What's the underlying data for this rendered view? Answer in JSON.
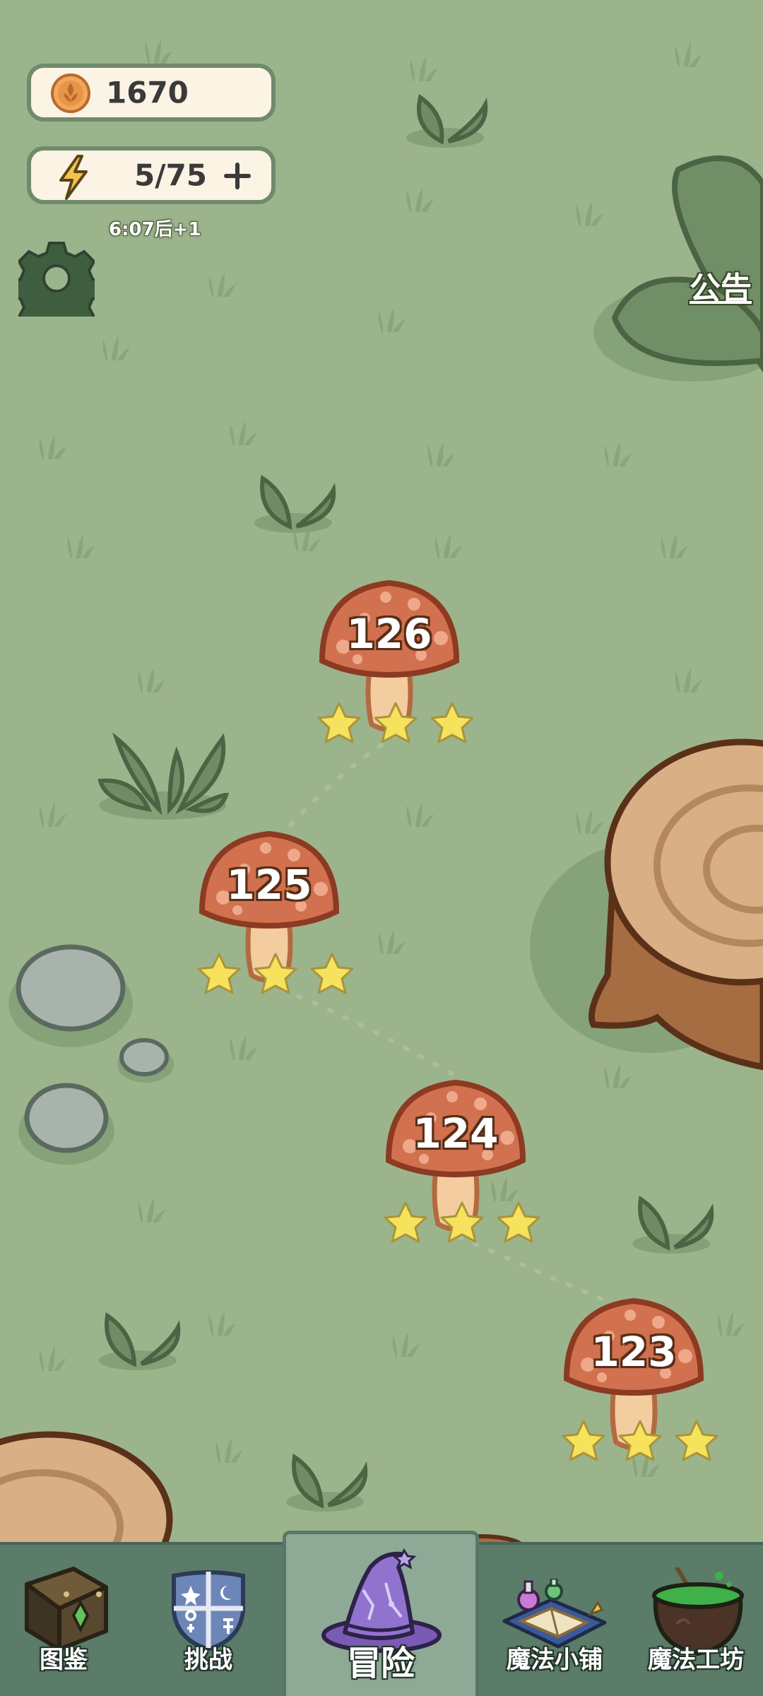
{
  "currency": {
    "coins": "1670",
    "icon": "coin-icon"
  },
  "energy": {
    "value": "5/75",
    "timer": "6:07后+1",
    "icon": "lightning-bolt-icon"
  },
  "notice": {
    "label": "公告"
  },
  "levels": [
    {
      "number": "126",
      "stars": 3
    },
    {
      "number": "125",
      "stars": 3
    },
    {
      "number": "124",
      "stars": 3
    },
    {
      "number": "123",
      "stars": 3
    }
  ],
  "nav": {
    "items": [
      {
        "label": "图鉴",
        "icon": "book-icon"
      },
      {
        "label": "挑战",
        "icon": "shield-icon"
      },
      {
        "label": "冒险",
        "icon": "wizard-hat-icon",
        "active": true
      },
      {
        "label": "魔法小铺",
        "icon": "shop-icon"
      },
      {
        "label": "魔法工坊",
        "icon": "cauldron-icon"
      }
    ]
  },
  "colors": {
    "background": "#9cb48c",
    "mushroom_cap": "#d2714f",
    "star": "#f6e25c",
    "nav_bar": "#5a7c68"
  }
}
